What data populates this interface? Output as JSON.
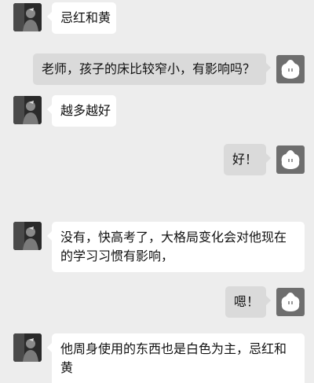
{
  "chat": {
    "messages": [
      {
        "from": "contact",
        "text": "忌红和黄"
      },
      {
        "from": "me",
        "text": "老师，孩子的床比较窄小，有影响吗？"
      },
      {
        "from": "contact",
        "text": "越多越好"
      },
      {
        "from": "me",
        "text": "好！"
      },
      {
        "from": "contact",
        "text": "没有，快高考了，大格局变化会对他现在的学习习惯有影响，"
      },
      {
        "from": "me",
        "text": "嗯！"
      },
      {
        "from": "contact",
        "text": "他周身使用的东西也是白色为主，忌红和黄"
      }
    ]
  },
  "icons": {
    "contact_avatar": "person-photo-avatar",
    "my_avatar": "cartoon-face-avatar"
  },
  "colors": {
    "background": "#ededed",
    "incoming_bubble": "#ffffff",
    "outgoing_bubble": "#dadada",
    "my_avatar_bg": "#6e6e6e"
  }
}
